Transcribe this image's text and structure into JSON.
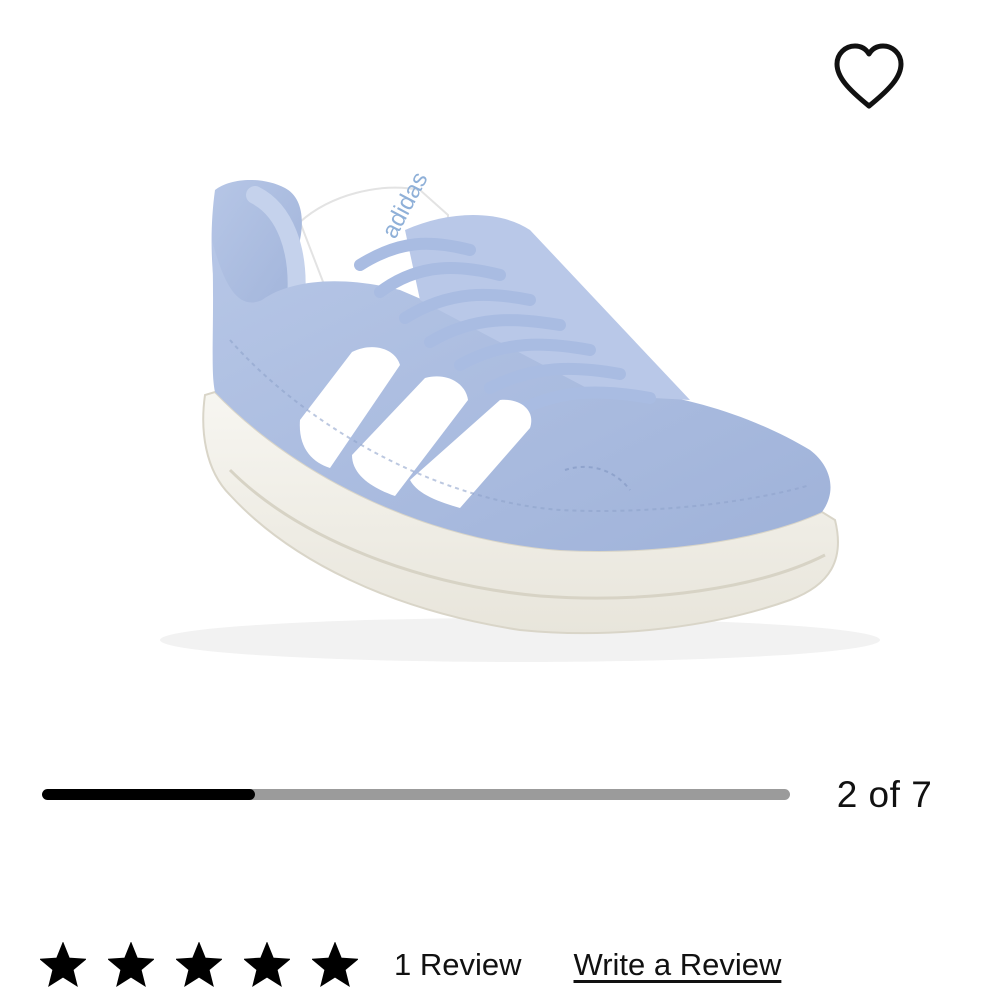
{
  "product": {
    "brand_print": "adidas",
    "images_total": 7
  },
  "carousel": {
    "counter": "2 of 7",
    "current": 2,
    "total": 7,
    "progress_fraction": 0.285
  },
  "favorite": {
    "icon": "heart-outline-icon"
  },
  "rating": {
    "stars_filled": 5,
    "stars_total": 5,
    "review_count_label": "1 Review",
    "write_review_label": "Write a Review"
  },
  "colors": {
    "shoe_suede": "#aebfe0",
    "shoe_shadow": "#8fa3cc",
    "stripes": "#ffffff",
    "sole": "#f3f1ea",
    "progress_fill": "#000000",
    "progress_track": "#9b9b9b",
    "text": "#111111"
  }
}
